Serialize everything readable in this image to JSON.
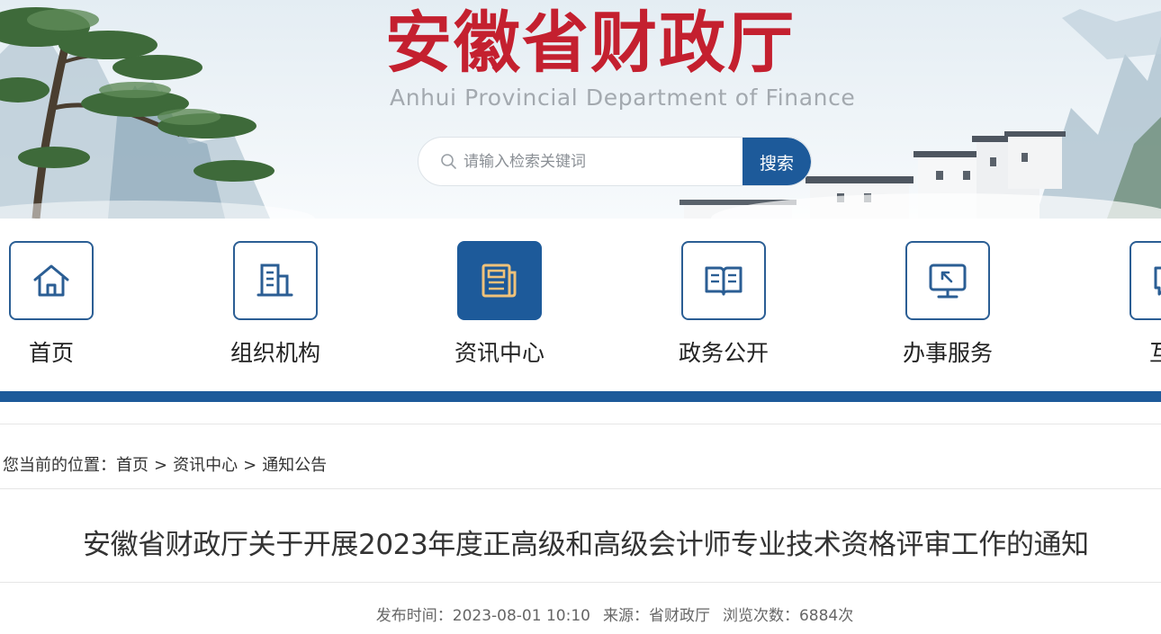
{
  "header": {
    "title": "安徽省财政厅",
    "subtitle": "Anhui Provincial Department of Finance",
    "brand_color": "#c4202f"
  },
  "search": {
    "placeholder": "请输入检索关键词",
    "button_label": "搜索",
    "icon": "search-icon"
  },
  "nav": {
    "accent": "#1d5a9a",
    "items": [
      {
        "label": "首页",
        "icon": "home-icon",
        "active": false
      },
      {
        "label": "组织机构",
        "icon": "building-icon",
        "active": false
      },
      {
        "label": "资讯中心",
        "icon": "news-icon",
        "active": true
      },
      {
        "label": "政务公开",
        "icon": "open-book-icon",
        "active": false
      },
      {
        "label": "办事服务",
        "icon": "monitor-icon",
        "active": false
      },
      {
        "label": "互动",
        "icon": "chat-icon",
        "active": false
      }
    ]
  },
  "breadcrumb": {
    "prefix": "您当前的位置：",
    "items": [
      "首页",
      "资讯中心",
      "通知公告"
    ],
    "separator": ">"
  },
  "article": {
    "title": "安徽省财政厅关于开展2023年度正高级和高级会计师专业技术资格评审工作的通知",
    "published": "发布时间：2023-08-01 10:10",
    "source": "来源：省财政厅",
    "views": "浏览次数：6884次"
  }
}
